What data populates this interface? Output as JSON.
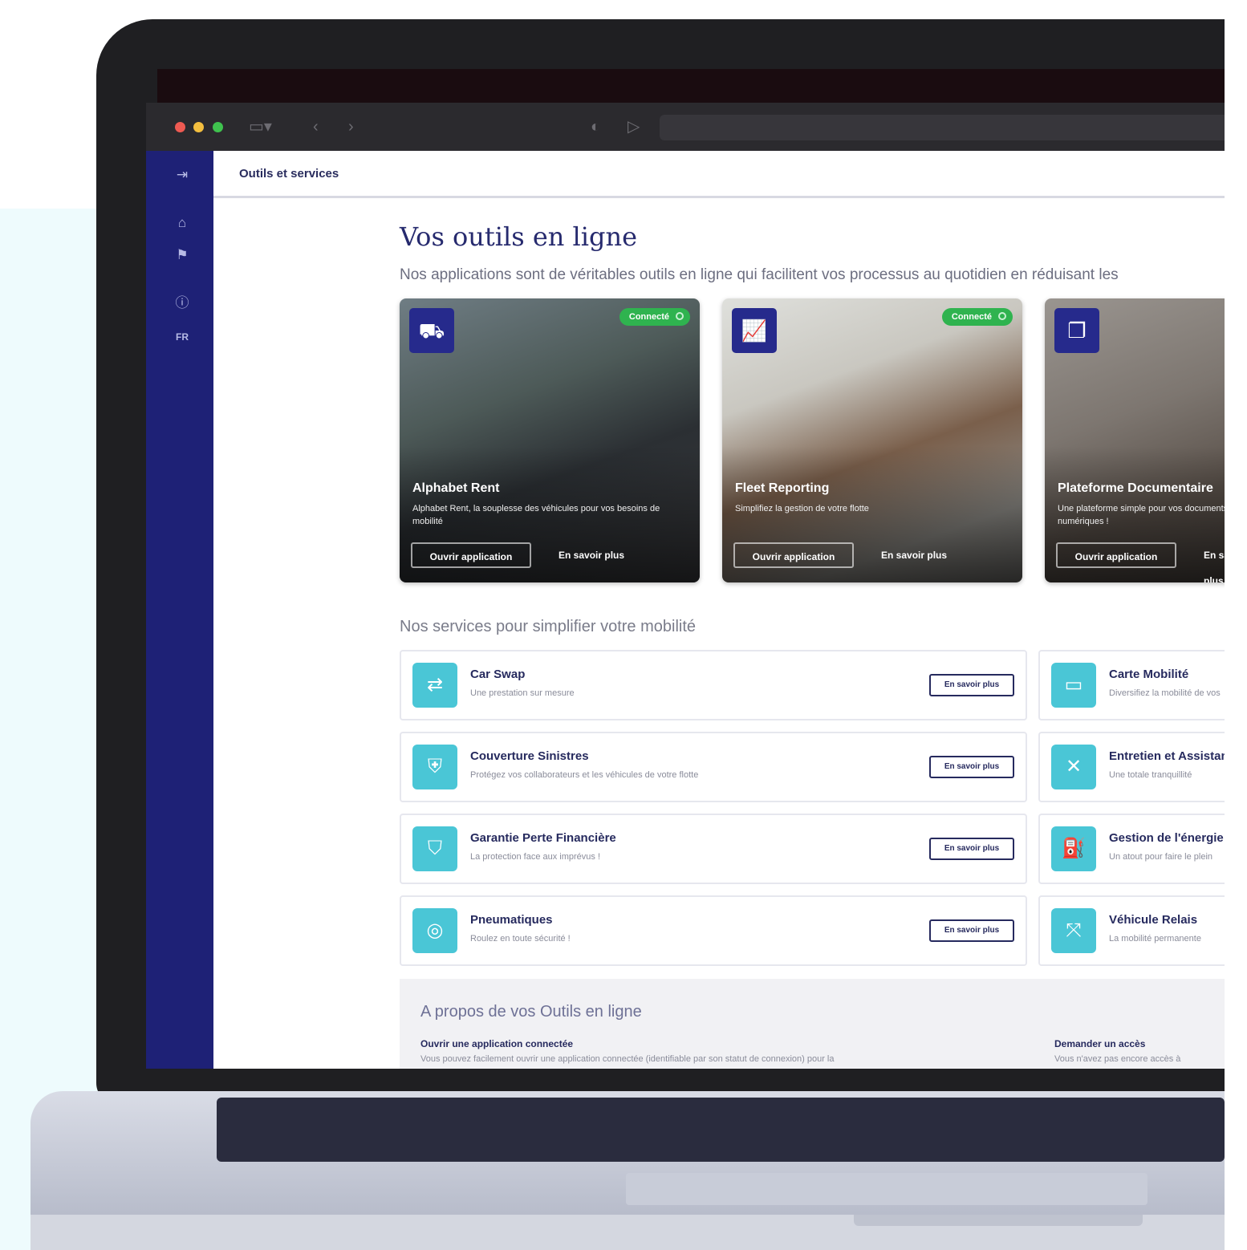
{
  "breadcrumb": "Outils et services",
  "page": {
    "title": "Vos outils en ligne",
    "subtitle": "Nos applications sont de véritables outils en ligne qui facilitent vos processus au quotidien en réduisant les"
  },
  "sidebar": {
    "icons": [
      "logout-icon",
      "home-icon",
      "flag-icon",
      "help-icon",
      "language-icon"
    ],
    "language_label": "FR"
  },
  "apps": [
    {
      "name": "Alphabet Rent",
      "description": "Alphabet Rent, la souplesse des véhicules pour vos besoins de mobilité",
      "status": "Connecté",
      "open_label": "Ouvrir application",
      "more_label": "En savoir plus",
      "icon": "car-icon"
    },
    {
      "name": "Fleet Reporting",
      "description": "Simplifiez la gestion de votre flotte",
      "status": "Connecté",
      "open_label": "Ouvrir application",
      "more_label": "En savoir plus",
      "icon": "chart-icon"
    },
    {
      "name": "Plateforme Documentaire",
      "description": "Une plateforme simple pour vos documents numériques !",
      "status": "",
      "open_label": "Ouvrir application",
      "more_label": "En savoir plus",
      "icon": "documents-icon"
    }
  ],
  "services": {
    "title": "Nos services pour simplifier votre mobilité",
    "button_label": "En savoir plus",
    "left": [
      {
        "name": "Car Swap",
        "description": "Une prestation sur mesure",
        "icon": "car-swap-icon"
      },
      {
        "name": "Couverture Sinistres",
        "description": "Protégez vos collaborateurs et les véhicules de votre flotte",
        "icon": "shield-car-icon"
      },
      {
        "name": "Garantie Perte Financière",
        "description": "La protection face aux imprévus !",
        "icon": "shield-icon"
      },
      {
        "name": "Pneumatiques",
        "description": "Roulez en toute sécurité !",
        "icon": "tire-icon"
      }
    ],
    "right": [
      {
        "name": "Carte Mobilité",
        "description": "Diversifiez la mobilité de vos",
        "icon": "card-icon"
      },
      {
        "name": "Entretien et Assistance",
        "description": "Une totale tranquillité",
        "icon": "wrench-icon"
      },
      {
        "name": "Gestion de l'énergie",
        "description": "Un atout pour faire le plein",
        "icon": "fuel-icon"
      },
      {
        "name": "Véhicule Relais",
        "description": "La mobilité permanente",
        "icon": "relay-car-icon"
      }
    ]
  },
  "about": {
    "title": "A propos de vos Outils en ligne",
    "col1_heading": "Ouvrir une application connectée",
    "col1_text": "Vous pouvez facilement ouvrir une application connectée (identifiable par son statut de connexion) pour la",
    "col2_heading": "Demander un accès",
    "col2_text": "Vous n'avez pas encore accès à"
  }
}
